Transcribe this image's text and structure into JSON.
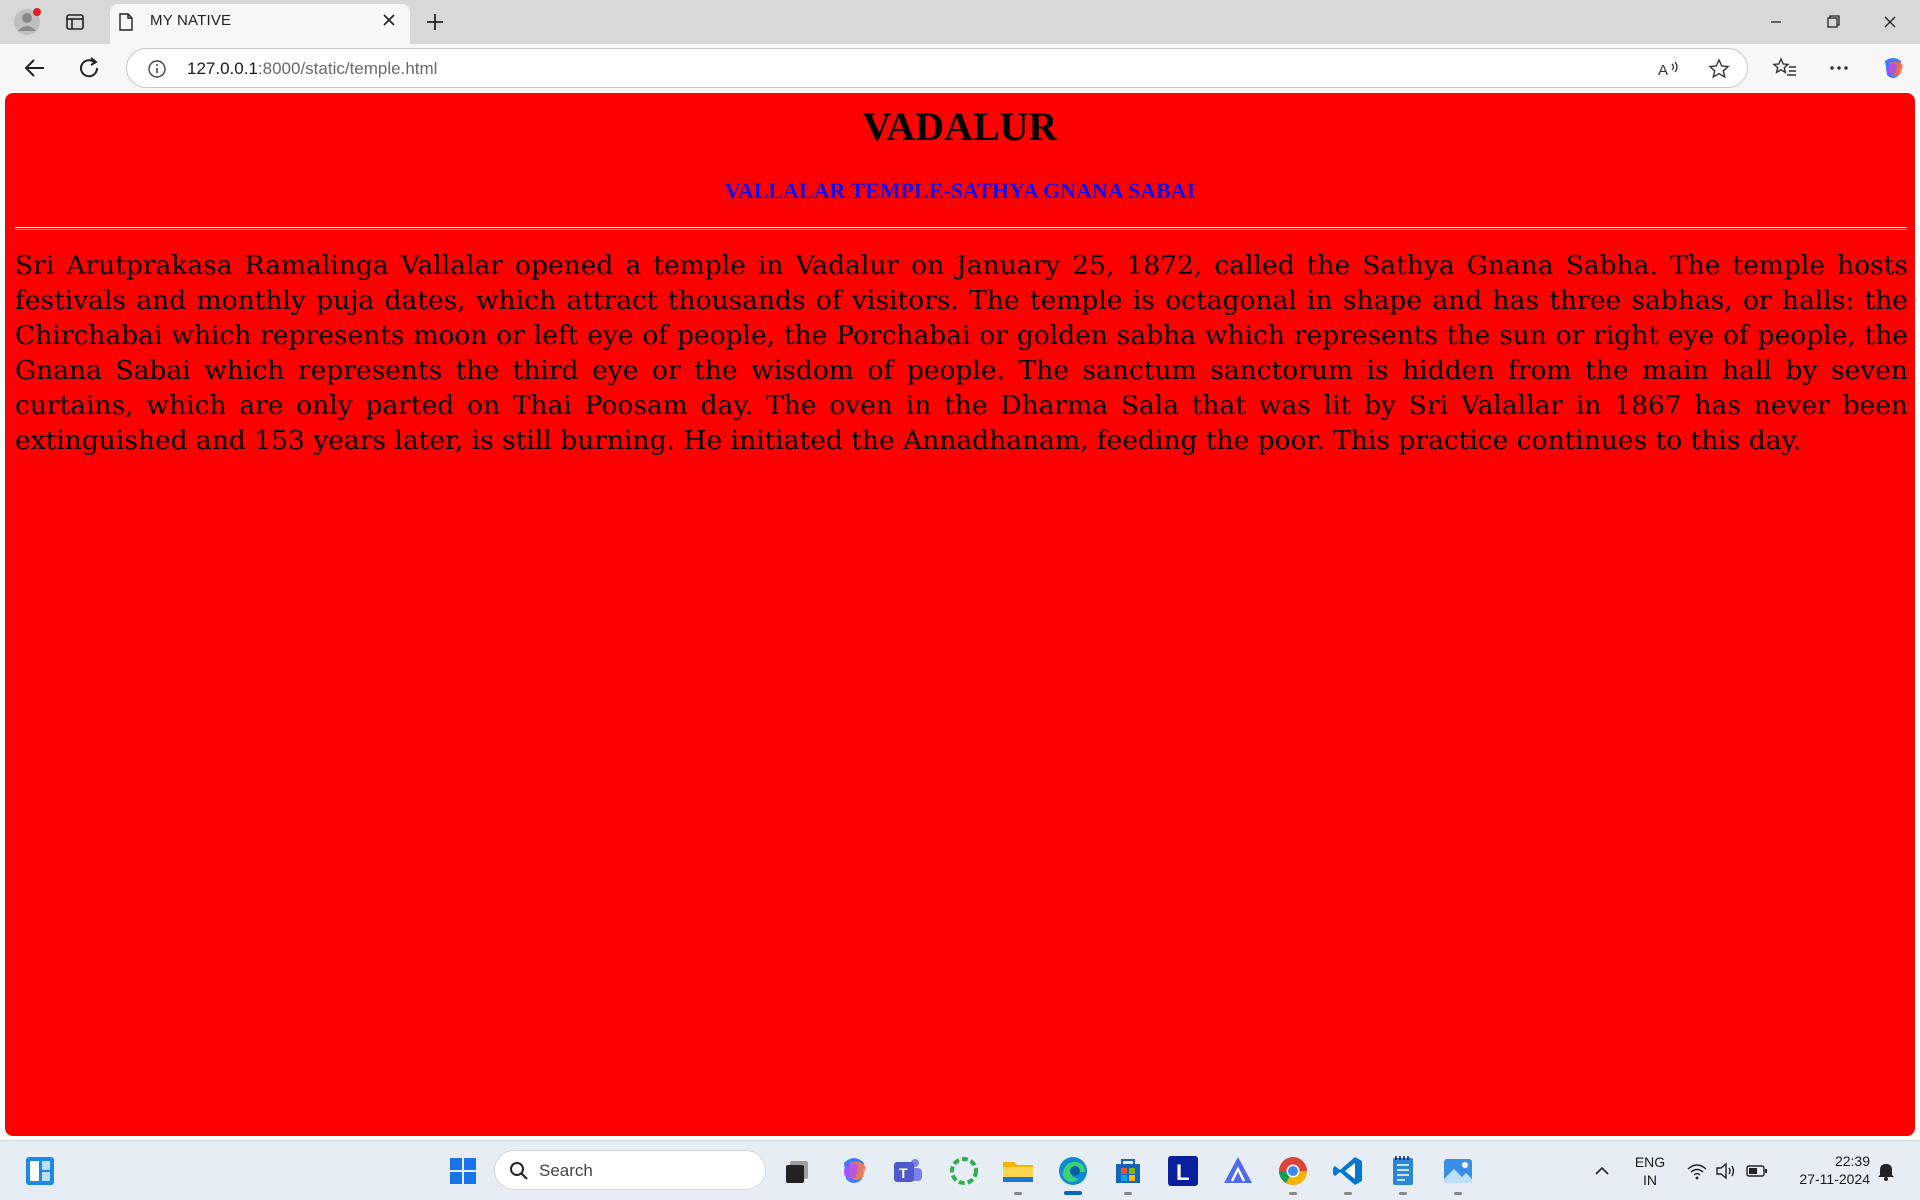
{
  "browser": {
    "tab_title": "MY NATIVE",
    "url_host": "127.0.0.1",
    "url_path": ":8000/static/temple.html"
  },
  "page": {
    "heading": "VADALUR",
    "subheading": "VALLALAR TEMPLE-SATHYA GNANA SABAI",
    "paragraph": "Sri Arutprakasa Ramalinga Vallalar opened a temple in Vadalur on January 25, 1872, called the Sathya Gnana Sabha. The temple hosts festivals and monthly puja dates, which attract thousands of visitors. The temple is octagonal in shape and has three sabhas, or halls: the Chirchabai which represents moon or left eye of people, the Porchabai or golden sabha which represents the sun or right eye of people, the Gnana Sabai which represents the third eye or the wisdom of people. The sanctum sanctorum is hidden from the main hall by seven curtains, which are only parted on Thai Poosam day. The oven in the Dharma Sala that was lit by Sri Valallar in 1867 has never been extinguished and 153 years later, is still burning. He initiated the Annadhanam, feeding the poor. This practice continues to this day.",
    "colors": {
      "background": "#ff0000",
      "subheading": "#1010ee"
    }
  },
  "taskbar": {
    "search_placeholder": "Search",
    "language_line1": "ENG",
    "language_line2": "IN",
    "time": "22:39",
    "date": "27-11-2024",
    "pinned_icons": [
      "widgets-icon",
      "start-icon",
      "task-view-icon",
      "copilot-icon",
      "teams-icon",
      "refresh-app-icon",
      "file-explorer-icon",
      "edge-icon",
      "store-icon",
      "l-app-icon",
      "arc-app-icon",
      "chrome-icon",
      "vscode-icon",
      "notepad-icon",
      "photos-icon"
    ]
  }
}
